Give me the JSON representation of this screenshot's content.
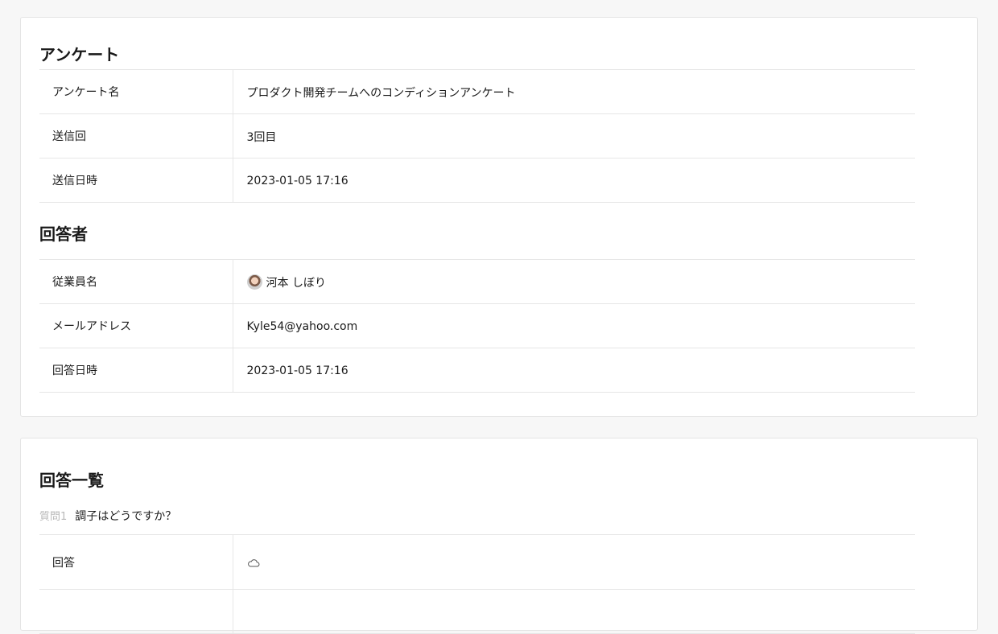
{
  "survey": {
    "title": "アンケート",
    "rows": [
      {
        "label": "アンケート名",
        "value": "プロダクト開発チームへのコンディションアンケート"
      },
      {
        "label": "送信回",
        "value": "3回目"
      },
      {
        "label": "送信日時",
        "value": "2023-01-05 17:16"
      }
    ]
  },
  "respondent": {
    "title": "回答者",
    "rows": [
      {
        "label": "従業員名",
        "value": "河本 しぼり",
        "icon": "avatar"
      },
      {
        "label": "メールアドレス",
        "value": "Kyle54@yahoo.com"
      },
      {
        "label": "回答日時",
        "value": "2023-01-05 17:16"
      }
    ]
  },
  "answers": {
    "title": "回答一覧",
    "questions": [
      {
        "number": "質問1",
        "text": "調子はどうですか？",
        "answer_label": "回答",
        "answer_icon": "cloud-icon"
      }
    ]
  },
  "colors": {
    "background": "#f7f7f7",
    "card": "#ffffff",
    "border": "#e6e6e6",
    "muted": "#b9b9b9"
  }
}
